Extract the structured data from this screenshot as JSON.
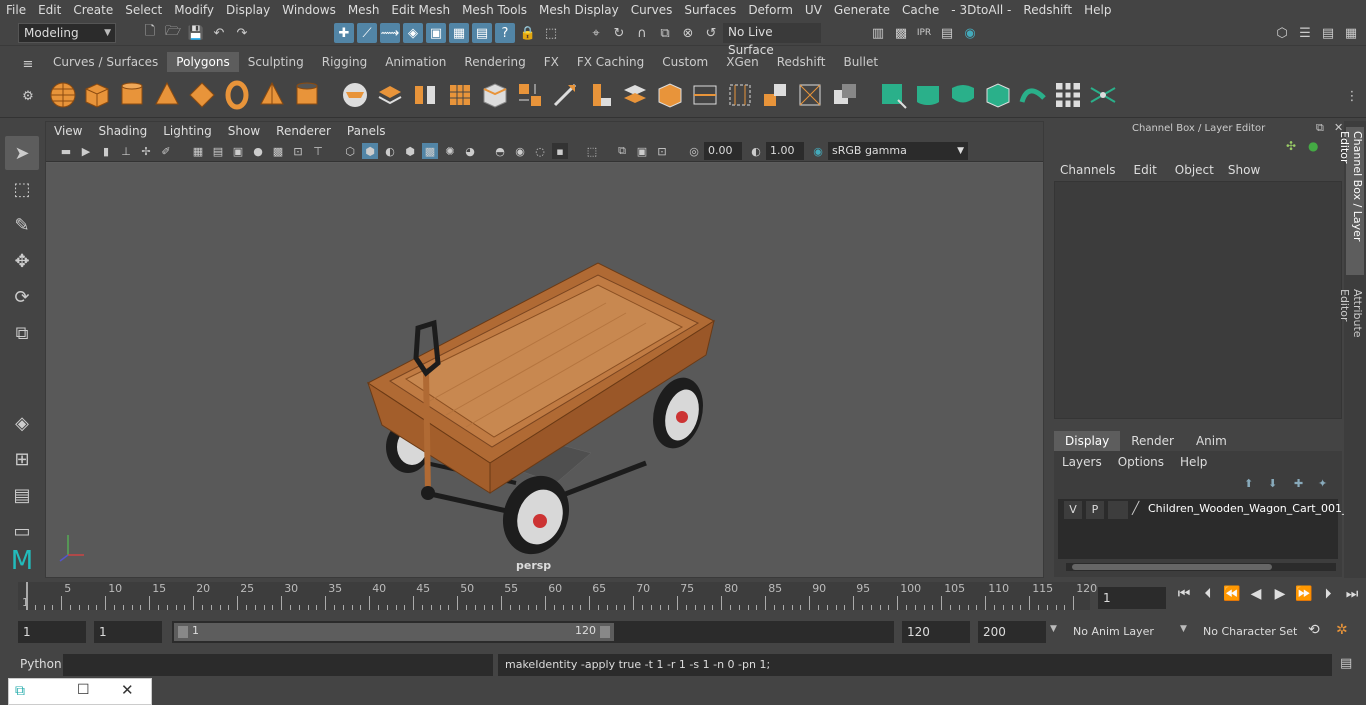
{
  "menubar": [
    "File",
    "Edit",
    "Create",
    "Select",
    "Modify",
    "Display",
    "Windows",
    "Mesh",
    "Edit Mesh",
    "Mesh Tools",
    "Mesh Display",
    "Curves",
    "Surfaces",
    "Deform",
    "UV",
    "Generate",
    "Cache",
    "- 3DtoAll -",
    "Redshift",
    "Help"
  ],
  "status": {
    "workspace": "Modeling",
    "live_surface": "No Live Surface"
  },
  "shelf_tabs": [
    "Curves / Surfaces",
    "Polygons",
    "Sculpting",
    "Rigging",
    "Animation",
    "Rendering",
    "FX",
    "FX Caching",
    "Custom",
    "XGen",
    "Redshift",
    "Bullet"
  ],
  "shelf_active": "Polygons",
  "viewport": {
    "menu": [
      "View",
      "Shading",
      "Lighting",
      "Show",
      "Renderer",
      "Panels"
    ],
    "exposure": "0.00",
    "gamma": "1.00",
    "color_space": "sRGB gamma",
    "camera_label": "persp"
  },
  "channel_box": {
    "title": "Channel Box / Layer Editor",
    "menu": [
      "Channels",
      "Edit",
      "Object",
      "Show"
    ],
    "layer_tabs": [
      "Display",
      "Render",
      "Anim"
    ],
    "layer_menu": [
      "Layers",
      "Options",
      "Help"
    ],
    "layer": {
      "v": "V",
      "p": "P",
      "name": "Children_Wooden_Wagon_Cart_001_"
    }
  },
  "side_tabs": [
    "Channel Box / Layer Editor",
    "Attribute Editor"
  ],
  "timeline": {
    "ticks": [
      "5",
      "10",
      "15",
      "20",
      "25",
      "30",
      "35",
      "40",
      "45",
      "50",
      "55",
      "60",
      "65",
      "70",
      "75",
      "80",
      "85",
      "90",
      "95",
      "100",
      "105",
      "110",
      "115",
      "120"
    ],
    "start_tick": "1",
    "current_frame": "1"
  },
  "range": {
    "start": "1",
    "playback_start": "1",
    "slider_start": "1",
    "slider_end": "120",
    "end": "120",
    "anim_end": "200",
    "anim_layer": "No Anim Layer",
    "char_set": "No Character Set"
  },
  "cmd": {
    "lang": "Python",
    "output": "makeIdentity -apply true -t 1 -r 1 -s 1 -n 0 -pn 1;"
  }
}
